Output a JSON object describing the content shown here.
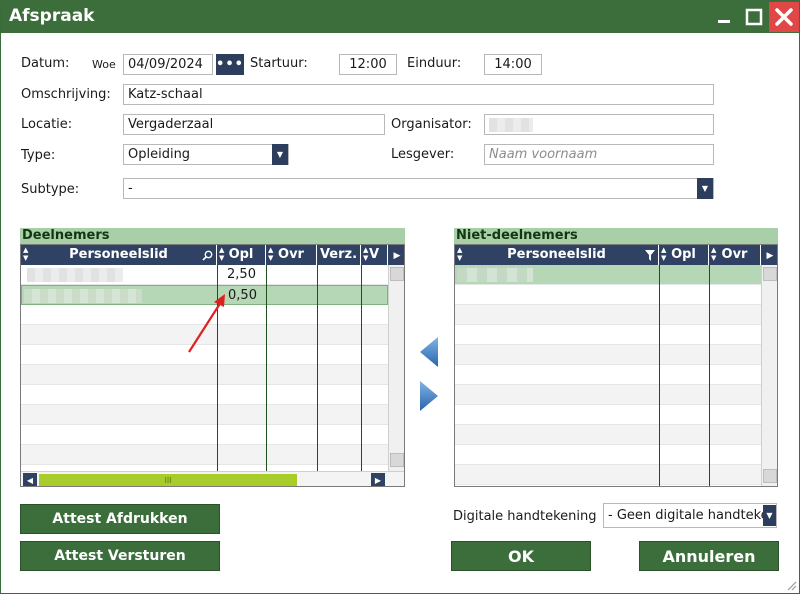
{
  "window": {
    "title": "Afspraak"
  },
  "form": {
    "datum_label": "Datum:",
    "day": "Woe",
    "datum_value": "04/09/2024",
    "dots": "•••",
    "startuur_label": "Startuur:",
    "startuur_value": "12:00",
    "einduur_label": "Einduur:",
    "einduur_value": "14:00",
    "omschrijving_label": "Omschrijving:",
    "omschrijving_value": "Katz-schaal",
    "locatie_label": "Locatie:",
    "locatie_value": "Vergaderzaal",
    "organisator_label": "Organisator:",
    "type_label": "Type:",
    "type_value": "Opleiding",
    "lesgever_label": "Lesgever:",
    "lesgever_placeholder": "Naam voornaam",
    "subtype_label": "Subtype:",
    "subtype_value": "-"
  },
  "deelnemers": {
    "title": "Deelnemers",
    "columns": [
      "Personeelslid",
      "Opl",
      "Ovr",
      "Verz.",
      "V"
    ],
    "rows": [
      {
        "opl": "2,50"
      },
      {
        "opl": "0,50"
      }
    ]
  },
  "niet_deelnemers": {
    "title": "Niet-deelnemers",
    "columns": [
      "Personeelslid",
      "Opl",
      "Ovr"
    ]
  },
  "footer": {
    "attest_afdrukken": "Attest Afdrukken",
    "attest_versturen": "Attest Versturen",
    "digitale_label": "Digitale handtekening",
    "digitale_value": "- Geen digitale handtekening -",
    "ok": "OK",
    "annuleren": "Annuleren"
  },
  "colors": {
    "title_bar": "#3c6e3c",
    "grid_header": "#2f4263",
    "section_header": "#a9cfa9",
    "selected_row": "#b6d7b6",
    "close_button": "#e04848",
    "arrow_blue": "#3f7fc4",
    "annotation_arrow": "#e02020"
  }
}
